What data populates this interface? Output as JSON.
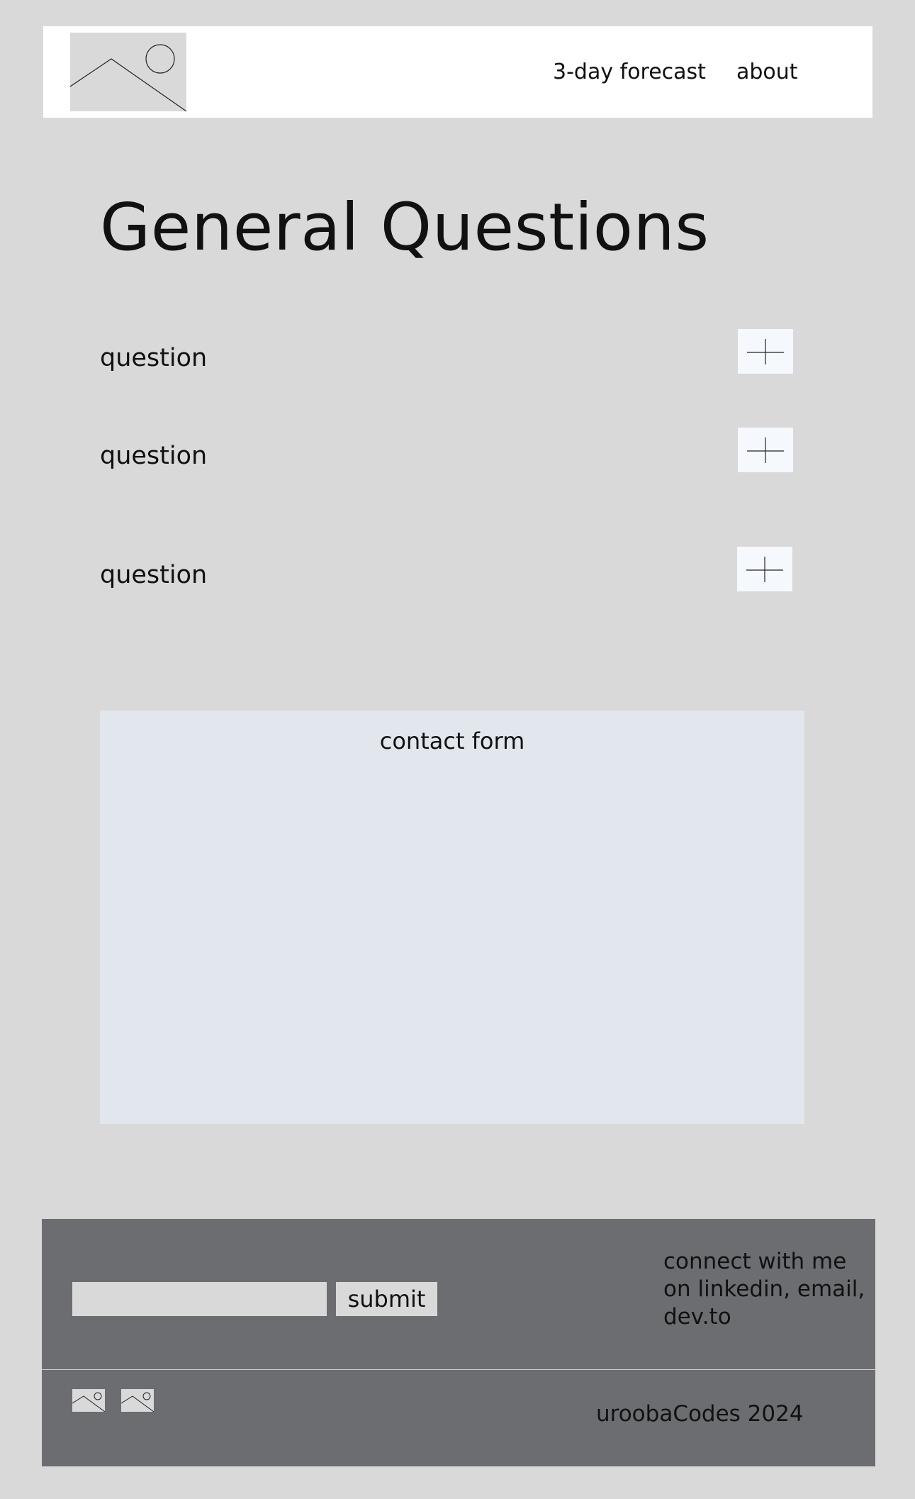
{
  "header": {
    "logo_icon": "image-placeholder-icon",
    "nav": [
      {
        "label": "3-day forecast"
      },
      {
        "label": "about"
      }
    ]
  },
  "main": {
    "title": "General Questions",
    "questions": [
      {
        "label": "question",
        "icon": "plus-icon"
      },
      {
        "label": "question",
        "icon": "plus-icon"
      },
      {
        "label": "question",
        "icon": "plus-icon"
      }
    ],
    "contact_form": {
      "title": "contact form"
    }
  },
  "footer": {
    "newsletter_value": "",
    "submit_label": "submit",
    "connect_text": "connect with me on linkedin, email, dev.to",
    "social_icons": [
      "image-placeholder-icon",
      "image-placeholder-icon"
    ],
    "copyright": "uroobaCodes 2024"
  },
  "colors": {
    "page_background": "#d9d9d9",
    "header_background": "#ffffff",
    "contact_form_background": "#e2e6ed",
    "footer_background": "#6c6d71",
    "expand_button_background": "#f5f8fc"
  }
}
